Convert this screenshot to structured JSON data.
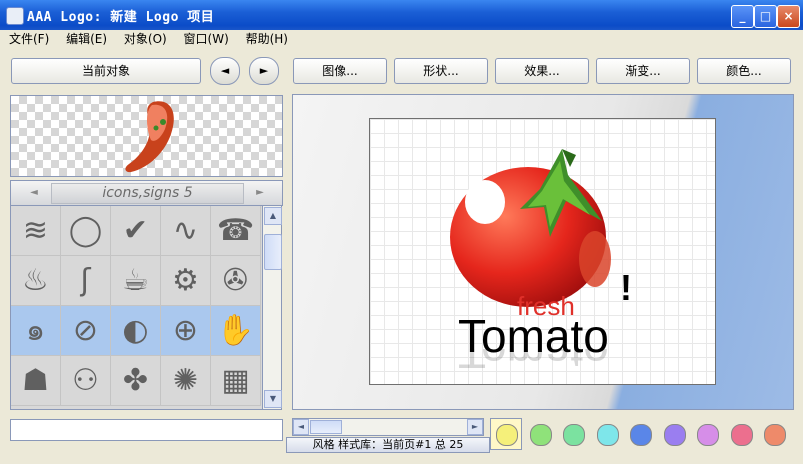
{
  "window": {
    "title": "AAA Logo: 新建 Logo 项目",
    "minimize_glyph": "_",
    "maximize_glyph": "□",
    "close_glyph": "×"
  },
  "menu": [
    "文件(F)",
    "编辑(E)",
    "对象(O)",
    "窗口(W)",
    "帮助(H)"
  ],
  "toolbar": {
    "current_object": "当前对象",
    "prev": "◄",
    "next": "►",
    "image": "图像...",
    "shape": "形状...",
    "effect": "效果...",
    "gradient": "渐变...",
    "color": "颜色..."
  },
  "library": {
    "title": "icons,signs 5",
    "left_arrow": "◄",
    "right_arrow": "►",
    "icons": [
      {
        "name": "water-waves-icon",
        "glyph": "≋",
        "selected": false
      },
      {
        "name": "swirl-ring-icon",
        "glyph": "◯",
        "selected": false
      },
      {
        "name": "swoosh-icon",
        "glyph": "✔",
        "selected": false
      },
      {
        "name": "wave-line-icon",
        "glyph": "∿",
        "selected": false
      },
      {
        "name": "telephone-icon",
        "glyph": "☎",
        "selected": false
      },
      {
        "name": "hot-cup-icon",
        "glyph": "♨",
        "selected": false
      },
      {
        "name": "s-curve-icon",
        "glyph": "ʃ",
        "selected": false
      },
      {
        "name": "cup-saucer-icon",
        "glyph": "☕",
        "selected": false
      },
      {
        "name": "gears-icon",
        "glyph": "⚙",
        "selected": false
      },
      {
        "name": "pinwheel-icon",
        "glyph": "✇",
        "selected": false
      },
      {
        "name": "curl-wave-icon",
        "glyph": "๑",
        "selected": true
      },
      {
        "name": "no-smoking-icon",
        "glyph": "⊘",
        "selected": true
      },
      {
        "name": "moon-face-icon",
        "glyph": "◐",
        "selected": true
      },
      {
        "name": "globe-icon",
        "glyph": "⊕",
        "selected": true
      },
      {
        "name": "hand-print-icon",
        "glyph": "✋",
        "selected": true
      },
      {
        "name": "turtle-icon",
        "glyph": "☗",
        "selected": false
      },
      {
        "name": "family-icon",
        "glyph": "⚇",
        "selected": false
      },
      {
        "name": "clover-icon",
        "glyph": "✤",
        "selected": false
      },
      {
        "name": "jellyfish-icon",
        "glyph": "✺",
        "selected": false
      },
      {
        "name": "brick-wall-icon",
        "glyph": "▦",
        "selected": false
      }
    ]
  },
  "logo": {
    "word_small": "fresh",
    "word_big": "Tomato",
    "exclamation": "!"
  },
  "status": "风格 样式库：当前页#1 总 25",
  "hscroll": {
    "left_arrow": "◄",
    "right_arrow": "►"
  },
  "vscroll": {
    "up_arrow": "▲",
    "down_arrow": "▼"
  },
  "swatches": [
    "#f5f07a",
    "#8fe27a",
    "#7be2a0",
    "#7ee6ea",
    "#5a86e8",
    "#9a7ef0",
    "#d68ee8",
    "#ec6f8e",
    "#ee8a6a"
  ],
  "selected_swatch": 0
}
